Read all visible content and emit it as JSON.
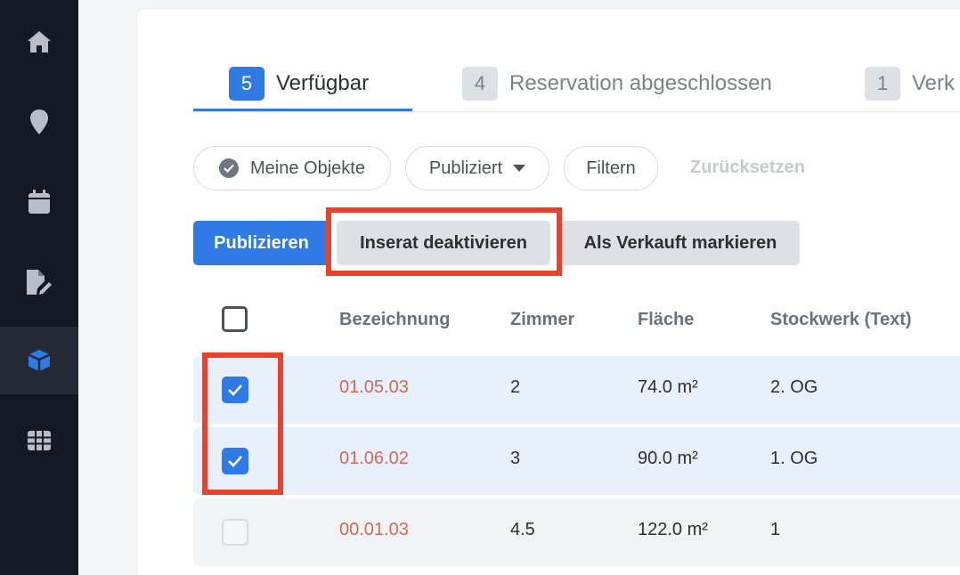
{
  "sidebar": {
    "items": [
      {
        "icon": "home-icon",
        "active": false
      },
      {
        "icon": "location-pin-icon",
        "active": false
      },
      {
        "icon": "calendar-icon",
        "active": false
      },
      {
        "icon": "document-edit-icon",
        "active": false
      },
      {
        "icon": "cube-icon",
        "active": true
      },
      {
        "icon": "grid-table-icon",
        "active": false
      }
    ]
  },
  "tabs": [
    {
      "count": "5",
      "label": "Verfügbar",
      "active": true
    },
    {
      "count": "4",
      "label": "Reservation abgeschlossen",
      "active": false
    },
    {
      "count": "1",
      "label": "Verk",
      "active": false
    }
  ],
  "filters": {
    "mine": "Meine Objekte",
    "published": "Publiziert",
    "filter": "Filtern",
    "reset": "Zurücksetzen"
  },
  "actions": {
    "publish": "Publizieren",
    "deactivate": "Inserat deaktivieren",
    "mark_sold": "Als Verkauft markieren"
  },
  "table": {
    "headers": [
      "Bezeichnung",
      "Zimmer",
      "Fläche",
      "Stockwerk (Text)"
    ],
    "rows": [
      {
        "checked": true,
        "code": "01.05.03",
        "rooms": "2",
        "area": "74.0 m²",
        "floor": "2. OG"
      },
      {
        "checked": true,
        "code": "01.06.02",
        "rooms": "3",
        "area": "90.0 m²",
        "floor": "1. OG"
      },
      {
        "checked": false,
        "code": "00.01.03",
        "rooms": "4.5",
        "area": "122.0 m²",
        "floor": "1"
      }
    ]
  },
  "colors": {
    "accent": "#2f7ae5",
    "highlight": "#e8412c",
    "code_text": "#cf6b5b",
    "sidebar_bg": "#141a23"
  }
}
